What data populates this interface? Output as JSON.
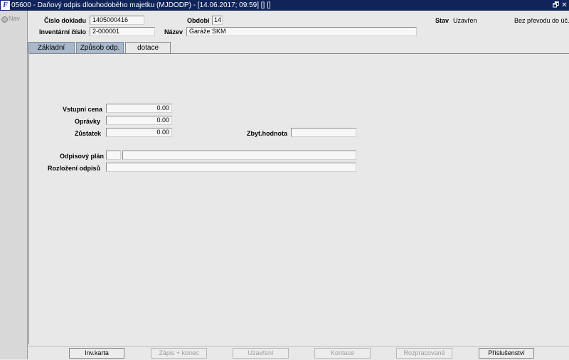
{
  "window": {
    "title": "05600 - Daňový odpis dlouhodobého majetku (MJDODP) - [14.06.2017; 09:59]  [] []",
    "restore_glyph": "🗗",
    "close_glyph": "✕"
  },
  "nav": {
    "label": "Nav"
  },
  "header": {
    "cislo_dokladu_label": "Číslo dokladu",
    "cislo_dokladu_value": "1405000416",
    "obdobi_label": "Období",
    "obdobi_value": "14",
    "stav_label": "Stav",
    "stav_value": "Uzavřen",
    "bez_prevodu": "Bez převodu do úč.",
    "inventarni_cislo_label": "Inventární číslo",
    "inventarni_cislo_value": "2-000001",
    "nazev_label": "Název",
    "nazev_value": "Garáže SKM"
  },
  "tabs": [
    {
      "label": "Základní"
    },
    {
      "label": "Způsob odp."
    },
    {
      "label": "dotace"
    }
  ],
  "form": {
    "vstupni_cena_label": "Vstupní cena",
    "vstupni_cena_value": "0.00",
    "opravky_label": "Oprávky",
    "opravky_value": "0.00",
    "zustatek_label": "Zůstatek",
    "zustatek_value": "0.00",
    "zbyt_hodnota_label": "Zbyt.hodnota",
    "zbyt_hodnota_value": "",
    "odpisovy_plan_label": "Odpisový plán",
    "odpisovy_plan_code": "",
    "odpisovy_plan_name": "",
    "rozlozeni_label": "Rozložení odpisů",
    "rozlozeni_value": ""
  },
  "buttons": [
    {
      "label": "Inv.karta",
      "enabled": true
    },
    {
      "label": "Zápis + konec",
      "enabled": false
    },
    {
      "label": "Uzavření",
      "enabled": false
    },
    {
      "label": "Kontace",
      "enabled": false
    },
    {
      "label": "Rozpracované",
      "enabled": false
    },
    {
      "label": "Příslušenství",
      "enabled": true
    }
  ]
}
